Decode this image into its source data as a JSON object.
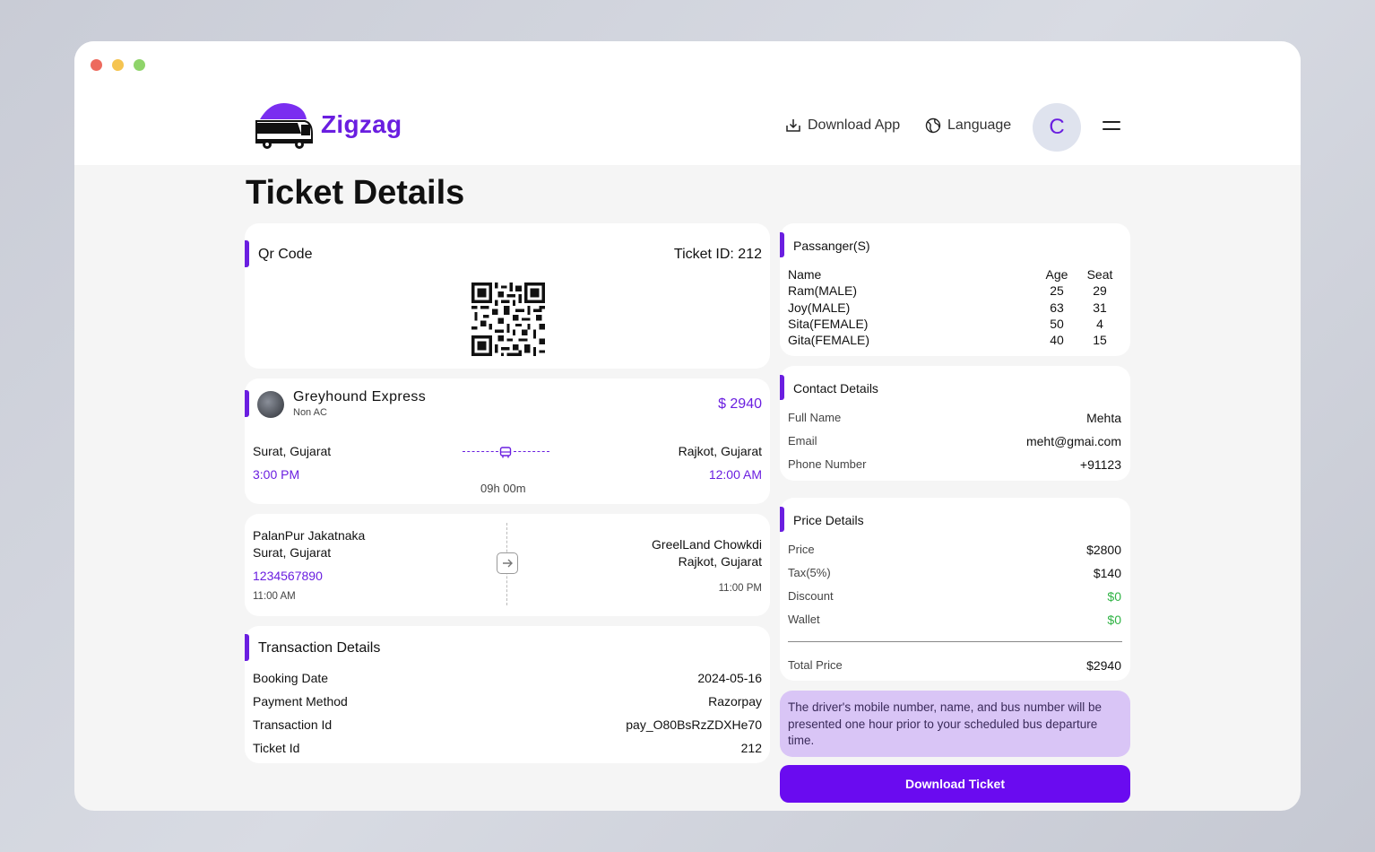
{
  "header": {
    "brand": "Zigzag",
    "download_app": "Download App",
    "language": "Language",
    "avatar_initial": "C"
  },
  "page_title": "Ticket Details",
  "qr_card": {
    "title": "Qr Code",
    "ticket_id": "Ticket ID: 212"
  },
  "bus": {
    "name": "Greyhound Express",
    "type": "Non AC",
    "price": "$ 2940",
    "from_city": "Surat, Gujarat",
    "to_city": "Rajkot, Gujarat",
    "depart_time": "3:00 PM",
    "arrive_time": "12:00 AM",
    "duration": "09h 00m"
  },
  "stops": {
    "pickup_name": "PalanPur Jakatnaka",
    "pickup_city": "Surat, Gujarat",
    "pickup_phone": "1234567890",
    "pickup_time": "11:00 AM",
    "drop_name": "GreelLand Chowkdi",
    "drop_city": "Rajkot, Gujarat",
    "drop_time": "11:00 PM"
  },
  "transaction": {
    "title": "Transaction Details",
    "rows": [
      {
        "label": "Booking Date",
        "value": "2024-05-16"
      },
      {
        "label": "Payment Method",
        "value": "Razorpay"
      },
      {
        "label": "Transaction Id",
        "value": "pay_O80BsRzZDXHe70"
      },
      {
        "label": "Ticket Id",
        "value": "212"
      }
    ]
  },
  "passengers": {
    "title": "Passanger(S)",
    "headers": {
      "name": "Name",
      "age": "Age",
      "seat": "Seat"
    },
    "rows": [
      {
        "name": "Ram(MALE)",
        "age": "25",
        "seat": "29"
      },
      {
        "name": "Joy(MALE)",
        "age": "63",
        "seat": "31"
      },
      {
        "name": "Sita(FEMALE)",
        "age": "50",
        "seat": "4"
      },
      {
        "name": "Gita(FEMALE)",
        "age": "40",
        "seat": "15"
      }
    ]
  },
  "contact": {
    "title": "Contact Details",
    "rows": [
      {
        "label": "Full Name",
        "value": "Mehta"
      },
      {
        "label": "Email",
        "value": "meht@gmai.com"
      },
      {
        "label": "Phone Number",
        "value": "+91123"
      }
    ]
  },
  "price": {
    "title": "Price Details",
    "rows": [
      {
        "label": "Price",
        "value": "$2800"
      },
      {
        "label": "Tax(5%)",
        "value": "$140"
      },
      {
        "label": "Discount",
        "value": "$0"
      },
      {
        "label": "Wallet",
        "value": "$0"
      }
    ],
    "total_label": "Total Price",
    "total_value": "$2940"
  },
  "note": "The driver's mobile number, name, and bus number will be presented one hour prior to your scheduled bus departure time.",
  "download_ticket": "Download Ticket",
  "colors": {
    "accent": "#6a1ee0",
    "button": "#6a0bf0",
    "note_bg": "#d9c5f6",
    "green": "#2fb344"
  }
}
